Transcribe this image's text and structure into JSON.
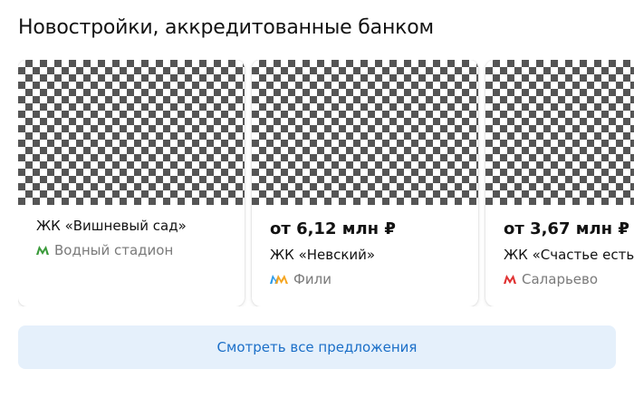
{
  "section": {
    "title": "Новостройки, аккредитованные банком"
  },
  "cards": [
    {
      "price": "",
      "name": "ЖК «Вишневый сад»",
      "metro": "Водный стадион",
      "metro_icon": "metro-line-icon",
      "metro_color": "#3a9a3a"
    },
    {
      "price": "от 6,12 млн ₽",
      "name": "ЖК «Невский»",
      "metro": "Фили",
      "metro_icon": "metro-line-icon",
      "metro_colors": [
        "#2d9be8",
        "#f5a623"
      ]
    },
    {
      "price": "от 3,67 млн ₽",
      "name": "ЖК «Счастье есть»",
      "metro": "Саларьево",
      "metro_icon": "metro-line-icon",
      "metro_color": "#e03131"
    }
  ],
  "cta": {
    "label": "Смотреть все предложения"
  }
}
